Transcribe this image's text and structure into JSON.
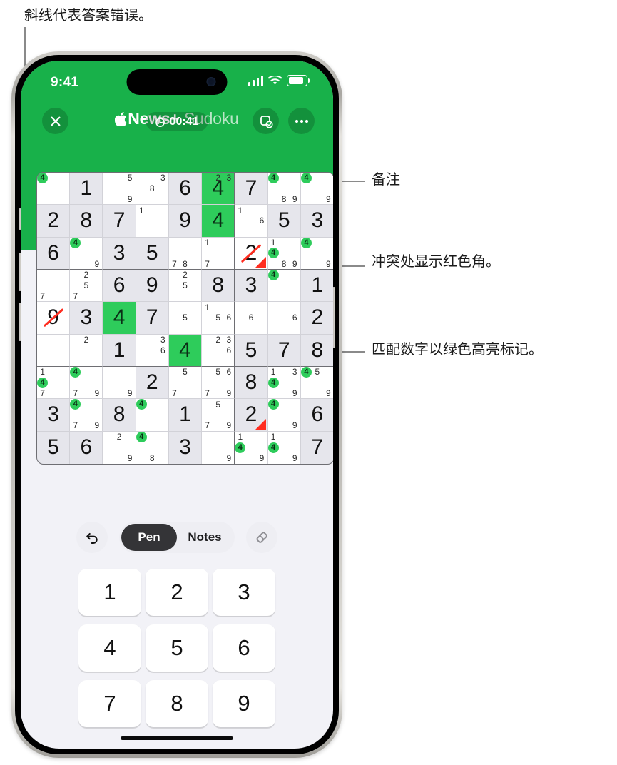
{
  "annotations": [
    {
      "id": "top",
      "text": "斜线代表答案错误。"
    },
    {
      "id": "notes",
      "text": "备注"
    },
    {
      "id": "conflict",
      "text": "冲突处显示红色角。"
    },
    {
      "id": "match",
      "text": "匹配数字以绿色高亮标记。"
    }
  ],
  "status_bar": {
    "time": "9:41",
    "cellular_icon": "signal-bars-icon",
    "wifi_icon": "wifi-icon",
    "battery_icon": "battery-icon"
  },
  "header": {
    "close_icon": "close-icon",
    "brand": "News+",
    "title_suffix": "Sudoku",
    "apple_logo_icon": "apple-logo-icon",
    "save_icon": "save-puzzle-icon",
    "more_icon": "more-options-icon",
    "timer_icon": "clock-icon",
    "timer": "00:41",
    "accent_green": "#18b14a",
    "highlight_green": "#2ecc5b",
    "conflict_red": "#ff2d20"
  },
  "toolbar": {
    "undo_icon": "undo-arrow-icon",
    "pen_label": "Pen",
    "notes_label": "Notes",
    "active_mode": "Pen",
    "eraser_icon": "eraser-icon"
  },
  "keypad": {
    "keys": [
      "1",
      "2",
      "3",
      "4",
      "5",
      "6",
      "7",
      "8",
      "9"
    ]
  },
  "board": {
    "rows": [
      [
        {
          "notes": [
            null,
            null,
            null,
            null,
            null,
            null,
            null,
            null,
            null
          ],
          "green": [
            "4"
          ],
          "greenPos": 0
        },
        {
          "value": "1",
          "given": true
        },
        {
          "notes": [
            null,
            null,
            "5",
            null,
            null,
            null,
            null,
            null,
            "9"
          ]
        },
        {
          "notes": [
            null,
            null,
            "3",
            null,
            "8",
            null,
            null,
            null,
            null
          ]
        },
        {
          "value": "6",
          "given": true
        },
        {
          "value": "4",
          "highlight": true,
          "hideTop": true,
          "notes": [
            null,
            "2",
            "3",
            null,
            null,
            null,
            null,
            null,
            null
          ],
          "noteOnly": true
        },
        {
          "value": "7",
          "given": true
        },
        {
          "notes": [
            null,
            null,
            null,
            null,
            null,
            null,
            null,
            "8",
            "9"
          ],
          "green": [
            "4"
          ],
          "greenPos": 0
        },
        {
          "notes": [
            null,
            null,
            null,
            null,
            null,
            null,
            null,
            null,
            "9"
          ],
          "green": [
            "4"
          ],
          "greenPos": 0
        }
      ],
      [
        {
          "value": "2",
          "given": true
        },
        {
          "value": "8",
          "given": true
        },
        {
          "value": "7",
          "given": true
        },
        {
          "notes": [
            "1",
            null,
            null,
            null,
            null,
            null,
            null,
            null,
            null
          ]
        },
        {
          "value": "9",
          "given": true
        },
        {
          "value": "4",
          "highlight": true
        },
        {
          "notes": [
            "1",
            null,
            null,
            null,
            null,
            "6",
            null,
            null,
            null
          ]
        },
        {
          "value": "5",
          "given": true
        },
        {
          "value": "3",
          "given": true
        }
      ],
      [
        {
          "value": "6",
          "given": true
        },
        {
          "notes": [
            null,
            null,
            null,
            null,
            null,
            null,
            null,
            null,
            "9"
          ],
          "green": [
            "4"
          ],
          "greenPos": 0
        },
        {
          "value": "3",
          "given": true
        },
        {
          "value": "5",
          "given": true
        },
        {
          "notes": [
            null,
            null,
            null,
            null,
            null,
            null,
            "7",
            "8",
            null
          ]
        },
        {
          "notes": [
            "1",
            null,
            null,
            null,
            null,
            null,
            "7",
            null,
            null
          ]
        },
        {
          "value": "2",
          "strike": true,
          "conflict": true
        },
        {
          "notes": [
            "1",
            null,
            null,
            null,
            null,
            null,
            null,
            "8",
            "9"
          ],
          "green": [
            "4"
          ],
          "greenPos": 3
        },
        {
          "notes": [
            null,
            null,
            null,
            null,
            null,
            null,
            null,
            null,
            "9"
          ],
          "green": [
            "4"
          ],
          "greenPos": 0
        }
      ],
      [
        {
          "notes": [
            null,
            null,
            null,
            null,
            null,
            null,
            "7",
            null,
            null
          ]
        },
        {
          "notes": [
            null,
            "2",
            null,
            null,
            "5",
            null,
            "7",
            null,
            null
          ]
        },
        {
          "value": "6",
          "given": true
        },
        {
          "value": "9",
          "given": true
        },
        {
          "notes": [
            null,
            "2",
            null,
            null,
            "5",
            null,
            null,
            null,
            null
          ]
        },
        {
          "value": "8",
          "given": true
        },
        {
          "value": "3",
          "given": true
        },
        {
          "green": [
            "4"
          ],
          "greenPos": 0
        },
        {
          "value": "1",
          "given": true
        }
      ],
      [
        {
          "value": "9",
          "strike": true
        },
        {
          "value": "3",
          "given": true
        },
        {
          "value": "4",
          "highlight": true
        },
        {
          "value": "7",
          "given": true
        },
        {
          "notes": [
            null,
            null,
            null,
            null,
            "5",
            null,
            null,
            null,
            null
          ]
        },
        {
          "notes": [
            "1",
            null,
            null,
            null,
            "5",
            "6",
            null,
            null,
            null
          ]
        },
        {
          "notes": [
            null,
            null,
            null,
            null,
            "6",
            null,
            null,
            null,
            null
          ]
        },
        {
          "notes": [
            null,
            null,
            null,
            null,
            null,
            "6",
            null,
            null,
            null
          ]
        },
        {
          "value": "2",
          "given": true
        }
      ],
      [
        {},
        {
          "notes": [
            null,
            "2",
            null,
            null,
            null,
            null,
            null,
            null,
            null
          ]
        },
        {
          "value": "1",
          "given": true
        },
        {
          "notes": [
            null,
            null,
            "3",
            null,
            null,
            "6",
            null,
            null,
            null
          ]
        },
        {
          "value": "4",
          "highlight": true
        },
        {
          "notes": [
            null,
            "2",
            "3",
            null,
            null,
            "6",
            null,
            null,
            null
          ]
        },
        {
          "value": "5",
          "given": true
        },
        {
          "value": "7",
          "given": true
        },
        {
          "value": "8",
          "given": true
        }
      ],
      [
        {
          "notes": [
            "1",
            null,
            null,
            null,
            null,
            null,
            "7",
            null,
            null
          ],
          "green": [
            "4"
          ],
          "greenPos": 3
        },
        {
          "notes": [
            null,
            null,
            null,
            null,
            null,
            null,
            "7",
            null,
            "9"
          ],
          "green": [
            "4"
          ],
          "greenPos": 0
        },
        {
          "notes": [
            null,
            null,
            null,
            null,
            null,
            null,
            null,
            null,
            "9"
          ]
        },
        {
          "value": "2",
          "given": true
        },
        {
          "notes": [
            null,
            "5",
            null,
            null,
            null,
            null,
            "7",
            null,
            null
          ]
        },
        {
          "notes": [
            null,
            "5",
            "6",
            null,
            null,
            null,
            "7",
            null,
            "9"
          ]
        },
        {
          "value": "8",
          "given": true
        },
        {
          "notes": [
            "1",
            null,
            "3",
            null,
            null,
            null,
            null,
            null,
            "9"
          ],
          "green": [
            "4"
          ],
          "greenPos": 3
        },
        {
          "notes": [
            null,
            "5",
            null,
            null,
            null,
            null,
            null,
            null,
            "9"
          ],
          "green": [
            "4"
          ],
          "greenPos": 0
        }
      ],
      [
        {
          "value": "3",
          "given": true
        },
        {
          "notes": [
            null,
            null,
            null,
            null,
            null,
            null,
            "7",
            null,
            "9"
          ],
          "green": [
            "4"
          ],
          "greenPos": 0
        },
        {
          "value": "8",
          "given": true
        },
        {
          "green": [
            "4"
          ],
          "greenPos": 0
        },
        {
          "value": "1",
          "given": true
        },
        {
          "notes": [
            null,
            "5",
            null,
            null,
            null,
            null,
            "7",
            null,
            "9"
          ]
        },
        {
          "value": "2",
          "given": true,
          "conflict": true
        },
        {
          "notes": [
            null,
            null,
            null,
            null,
            null,
            null,
            null,
            null,
            "9"
          ],
          "green": [
            "4"
          ],
          "greenPos": 0
        },
        {
          "value": "6",
          "given": true
        }
      ],
      [
        {
          "value": "5",
          "given": true
        },
        {
          "value": "6",
          "given": true
        },
        {
          "notes": [
            null,
            "2",
            null,
            null,
            null,
            null,
            null,
            null,
            "9"
          ]
        },
        {
          "notes": [
            null,
            null,
            null,
            null,
            null,
            null,
            null,
            "8",
            null
          ],
          "green": [
            "4"
          ],
          "greenPos": 0
        },
        {
          "value": "3",
          "given": true
        },
        {
          "notes": [
            null,
            null,
            null,
            null,
            null,
            null,
            null,
            null,
            "9"
          ]
        },
        {
          "notes": [
            "1",
            null,
            null,
            null,
            null,
            null,
            null,
            null,
            "9"
          ],
          "green": [
            "4"
          ],
          "greenPos": 3
        },
        {
          "notes": [
            "1",
            null,
            null,
            null,
            null,
            null,
            null,
            null,
            "9"
          ],
          "green": [
            "4"
          ],
          "greenPos": 3
        },
        {
          "value": "7",
          "given": true
        }
      ]
    ]
  }
}
